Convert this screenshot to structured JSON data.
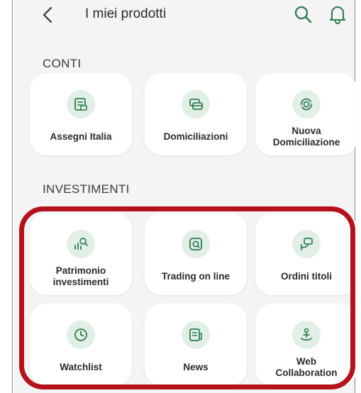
{
  "header": {
    "title": "I miei prodotti",
    "back_icon": "chevron-left-icon",
    "search_icon": "search-icon",
    "notification_icon": "bell-icon"
  },
  "sections": [
    {
      "title": "CONTI",
      "items": [
        {
          "label": "Assegni Italia",
          "icon": "cheque-icon"
        },
        {
          "label": "Domiciliazioni",
          "icon": "cards-icon"
        },
        {
          "label": "Nuova\nDomiciliazione",
          "icon": "coin-refresh-icon"
        }
      ]
    },
    {
      "title": "INVESTIMENTI",
      "items": [
        {
          "label": "Patrimonio\ninvestimenti",
          "icon": "portfolio-search-icon"
        },
        {
          "label": "Trading on line",
          "icon": "trading-screen-icon"
        },
        {
          "label": "Ordini titoli",
          "icon": "order-hand-icon"
        },
        {
          "label": "Watchlist",
          "icon": "clock-icon"
        },
        {
          "label": "News",
          "icon": "newspaper-icon"
        },
        {
          "label": "Web\nCollaboration",
          "icon": "collaboration-icon"
        }
      ]
    }
  ],
  "colors": {
    "accent": "#2e7d4f",
    "icon_background": "#e1efe6",
    "highlight": "#b5121b",
    "screen_background": "#f4f4f4"
  }
}
